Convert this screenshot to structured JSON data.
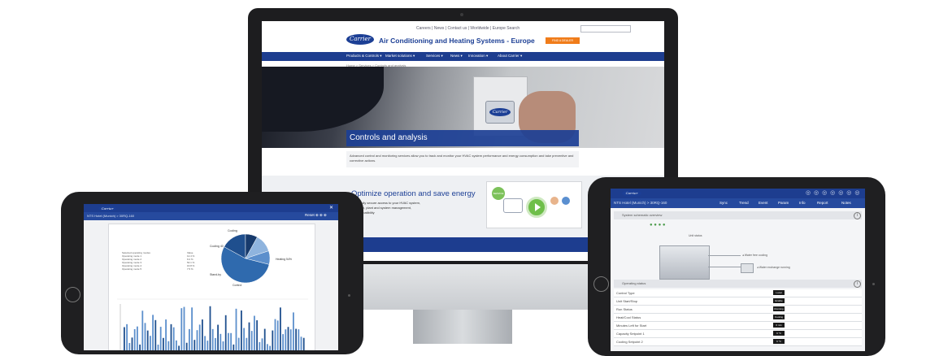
{
  "monitor": {
    "utility_links": "Careers | News | Contact us | Worldwide  | Europe    Search",
    "logo": "Carrier",
    "site_title": "Air Conditioning and Heating Systems - Europe",
    "cta": "FIND A DEALER",
    "nav": [
      "Products & Controls ▾",
      "Market solutions ▾",
      "Services ▾",
      "News ▾",
      "Innovation ▾",
      "About Carrier ▾"
    ],
    "breadcrumb": "Home  >  Services  >  Controls and analysis",
    "hero_logo": "Carrier",
    "hero_title": "Controls and analysis",
    "intro_text": "Advanced control and monitoring services allow you to track and monitor your HVAC system performance and energy consumption and take preventive and corrective actions.",
    "opt_title": "Optimize operation and save energy",
    "opt_lines": [
      "...and fully secure access to your HVAC system,",
      "...system, plant and system management,",
      "...8 compatibility"
    ],
    "video_badge": "SERVICE"
  },
  "left_tablet": {
    "logo": "Carrier",
    "close": "✕",
    "subheader": "NTS Hotel (Munich) > 30RQ-160",
    "tools": "Reset  ⊕  ⊕  ⊕",
    "pie_labels": [
      "Cooling",
      "Cooling 40",
      "Heating 54%",
      "Stand-by",
      "Control"
    ],
    "legend": [
      "Selected operating modes",
      "Operating mode 1",
      "Operating mode 2",
      "Operating mode 3",
      "Operating mode 4",
      "Operating mode 5"
    ],
    "legend_values": [
      "Value",
      "12.4 %",
      "9.2 %",
      "54.1 %",
      "16.8 %",
      "7.5 %"
    ]
  },
  "right_tablet": {
    "logo": "Carrier",
    "icons": "◎ ◎ ◎ ◎ ◎ ◎ ◎",
    "subheader": "NTS Hotel (Munich) > 30RQ-160",
    "tabs": [
      "Sync",
      "Trend",
      "Event",
      "Param",
      "Info",
      "Report",
      "Notes"
    ],
    "section1": "System schematic overview",
    "unit_label": "Unit status",
    "notes": [
      "◂ Water free cooling",
      "◂ Water exchange running"
    ],
    "section2": "Operating status",
    "rows": [
      {
        "k": "Control Type",
        "v": "Local"
      },
      {
        "k": "Unit Start/Stop",
        "v": "Enable"
      },
      {
        "k": "Run Status",
        "v": "Running"
      },
      {
        "k": "Heat/Cool Status",
        "v": "Cooling"
      },
      {
        "k": "Minutes Left for Start",
        "v": "0 min"
      },
      {
        "k": "Capacity Setpoint 1",
        "v": "6 °C"
      },
      {
        "k": "Cooling Setpoint 2",
        "v": "6 °C"
      }
    ]
  },
  "chart_data": {
    "type": "pie",
    "categories": [
      "Cooling",
      "Cooling 40",
      "Heating 54%",
      "Stand-by",
      "Control"
    ],
    "values": [
      12,
      9,
      54,
      17,
      8
    ]
  },
  "colors": {
    "brand_blue": "#1c3f95",
    "cta_orange": "#f07c1a",
    "status_green": "#6fbf4a"
  }
}
